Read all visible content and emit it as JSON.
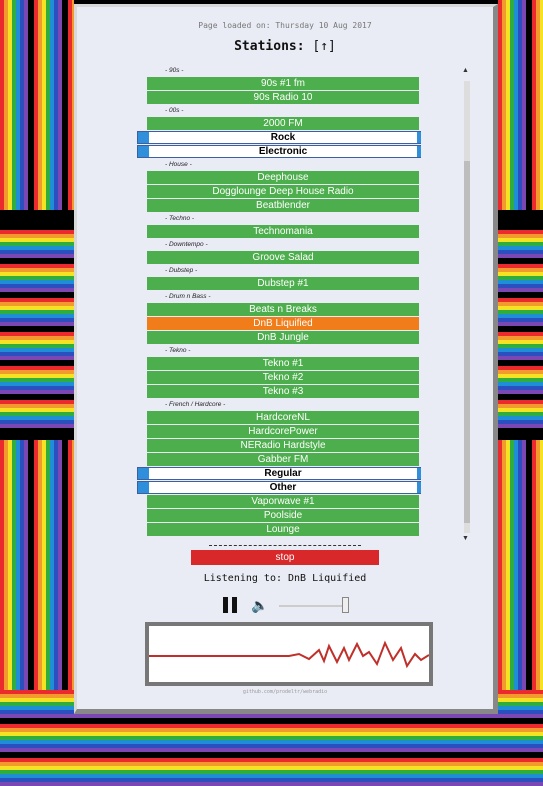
{
  "header": {
    "loaded_text": "Page loaded on: Thursday 10 Aug 2017",
    "title": "Stations:",
    "up_link": "[↑]"
  },
  "stations": [
    {
      "kind": "group",
      "label": "- 90s -"
    },
    {
      "kind": "station",
      "label": "90s #1 fm"
    },
    {
      "kind": "station",
      "label": "90s Radio 10"
    },
    {
      "kind": "group",
      "label": "- 00s -"
    },
    {
      "kind": "station",
      "label": "2000 FM"
    },
    {
      "kind": "category",
      "label": "Rock"
    },
    {
      "kind": "category",
      "label": "Electronic"
    },
    {
      "kind": "group",
      "label": "- House -"
    },
    {
      "kind": "station",
      "label": "Deephouse"
    },
    {
      "kind": "station",
      "label": "Dogglounge Deep House Radio"
    },
    {
      "kind": "station",
      "label": "Beatblender"
    },
    {
      "kind": "group",
      "label": "- Techno -"
    },
    {
      "kind": "station",
      "label": "Technomania"
    },
    {
      "kind": "group",
      "label": "- Downtempo -"
    },
    {
      "kind": "station",
      "label": "Groove Salad"
    },
    {
      "kind": "group",
      "label": "- Dubstep -"
    },
    {
      "kind": "station",
      "label": "Dubstep #1"
    },
    {
      "kind": "group",
      "label": "- Drum n Bass -"
    },
    {
      "kind": "station",
      "label": "Beats n Breaks"
    },
    {
      "kind": "station",
      "label": "DnB Liquified",
      "active": true
    },
    {
      "kind": "station",
      "label": "DnB Jungle"
    },
    {
      "kind": "group",
      "label": "- Tekno -"
    },
    {
      "kind": "station",
      "label": "Tekno #1"
    },
    {
      "kind": "station",
      "label": "Tekno #2"
    },
    {
      "kind": "station",
      "label": "Tekno #3"
    },
    {
      "kind": "group",
      "label": "- French / Hardcore -"
    },
    {
      "kind": "station",
      "label": "HardcoreNL"
    },
    {
      "kind": "station",
      "label": "HardcorePower"
    },
    {
      "kind": "station",
      "label": "NERadio Hardstyle"
    },
    {
      "kind": "station",
      "label": "Gabber FM"
    },
    {
      "kind": "category",
      "label": "Regular"
    },
    {
      "kind": "category",
      "label": "Other"
    },
    {
      "kind": "station",
      "label": "Vaporwave #1"
    },
    {
      "kind": "station",
      "label": "Poolside"
    },
    {
      "kind": "station",
      "label": "Lounge"
    }
  ],
  "player": {
    "stop_label": "stop",
    "listening_text": "Listening to: DnB Liquified",
    "volume_level": 1.0
  },
  "colors": {
    "station": "#4cae4c",
    "active": "#f07c1a",
    "stop": "#d8282a",
    "category_accent": "#2f8fdb",
    "waveform": "#c0302a"
  },
  "footer": {
    "credit": "github.com/prodeltr/webradio"
  }
}
